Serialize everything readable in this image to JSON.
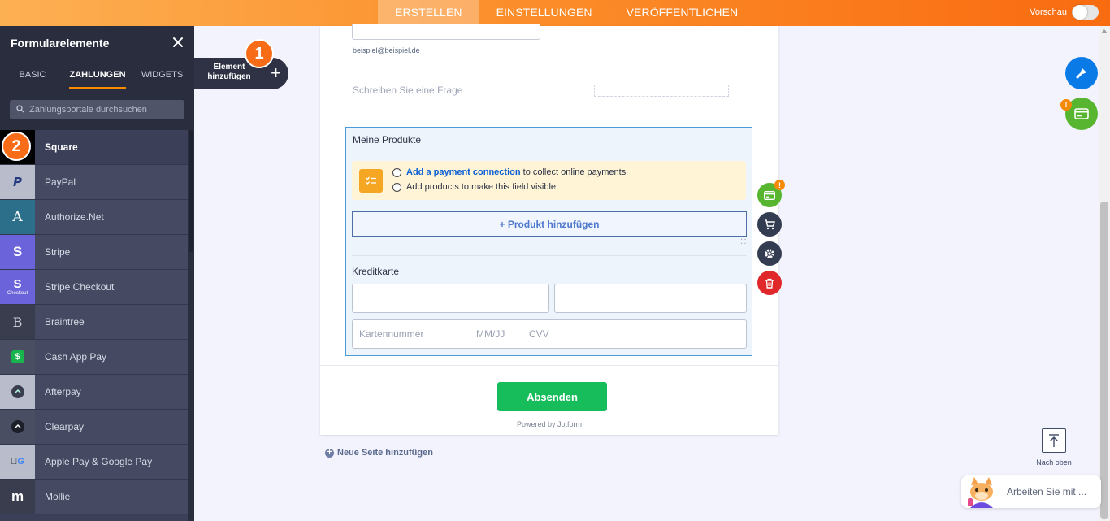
{
  "topbar": {
    "tabs": [
      {
        "label": "ERSTELLEN",
        "active": true
      },
      {
        "label": "EINSTELLUNGEN",
        "active": false
      },
      {
        "label": "VERÖFFENTLICHEN",
        "active": false
      }
    ],
    "preview_label": "Vorschau",
    "preview_on": false
  },
  "sidebar": {
    "title": "Formularelemente",
    "close_icon": "close-icon",
    "tabs": [
      {
        "label": "BASIC",
        "active": false
      },
      {
        "label": "ZAHLUNGEN",
        "active": true
      },
      {
        "label": "WIDGETS",
        "active": false
      }
    ],
    "search_placeholder": "Zahlungsportale durchsuchen",
    "items": [
      {
        "label": "Square",
        "icon": "square-icon",
        "selected": true
      },
      {
        "label": "PayPal",
        "icon": "paypal-icon"
      },
      {
        "label": "Authorize.Net",
        "icon": "authorize-net-icon"
      },
      {
        "label": "Stripe",
        "icon": "stripe-icon"
      },
      {
        "label": "Stripe Checkout",
        "icon": "stripe-checkout-icon",
        "sublabel": "Checkout"
      },
      {
        "label": "Braintree",
        "icon": "braintree-icon"
      },
      {
        "label": "Cash App Pay",
        "icon": "cash-app-icon"
      },
      {
        "label": "Afterpay",
        "icon": "afterpay-icon"
      },
      {
        "label": "Clearpay",
        "icon": "clearpay-icon"
      },
      {
        "label": "Apple Pay & Google Pay",
        "icon": "apple-google-pay-icon"
      },
      {
        "label": "Mollie",
        "icon": "mollie-icon"
      }
    ]
  },
  "step_badges": {
    "first": "1",
    "second": "2"
  },
  "add_element": {
    "label_line1": "Element",
    "label_line2": "hinzufügen",
    "plus": "+"
  },
  "form": {
    "email_sublabel": "beispiel@beispiel.de",
    "question_placeholder": "Schreiben Sie eine Frage",
    "product_field": {
      "title": "Meine Produkte",
      "notice_link": "Add a payment connection",
      "notice_line1_rest": "to collect online payments",
      "notice_line2": "Add products to make this field visible",
      "add_product_label": "+ Produkt hinzufügen",
      "credit_card_label": "Kreditkarte",
      "card_number_placeholder": "Kartennummer",
      "expiry_placeholder": "MM/JJ",
      "cvv_placeholder": "CVV"
    },
    "submit_label": "Absenden",
    "powered_by": "Powered by Jotform",
    "new_page_label": "Neue Seite hinzufügen",
    "field_action_badge": "!"
  },
  "right": {
    "fab_badge": "!",
    "back_to_top_label": "Nach oben",
    "ai_chat_text": "Arbeiten Sie mit ..."
  },
  "colors": {
    "accent_orange": "#fa8900",
    "sidebar_bg": "#3b3f58",
    "submit_green": "#18bd5b",
    "field_border": "#4b9ad8"
  }
}
